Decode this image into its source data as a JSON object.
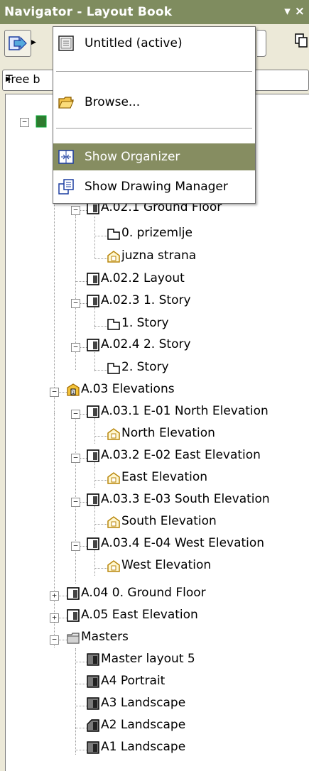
{
  "window": {
    "title": "Navigator - Layout Book",
    "controls": "▾ ×"
  },
  "filter": {
    "value": "Tree b"
  },
  "menu": {
    "items": [
      {
        "label": "Untitled (active)",
        "icon": "project-icon"
      },
      {
        "label": "Browse...",
        "icon": "folder-open-icon"
      },
      {
        "label": "Show Organizer",
        "icon": "organizer-icon",
        "highlighted": true
      },
      {
        "label": "Show Drawing Manager",
        "icon": "drawing-manager-icon"
      }
    ]
  },
  "tree": {
    "nodes": [
      {
        "label": "0. prizemlje",
        "icon": "floor-plan-icon"
      },
      {
        "label": "juzna strana",
        "icon": "elevation-view-icon"
      },
      {
        "label": "A.02.1 Ground Floor",
        "icon": "layout-icon"
      },
      {
        "label": "A.02.2 Layout",
        "icon": "layout-icon"
      },
      {
        "label": "A.02.3 1. Story",
        "icon": "layout-icon"
      },
      {
        "label": "1. Story",
        "icon": "floor-plan-icon"
      },
      {
        "label": "A.02.4 2. Story",
        "icon": "layout-icon"
      },
      {
        "label": "2. Story",
        "icon": "floor-plan-icon"
      },
      {
        "label": "A.03 Elevations",
        "icon": "subset-icon"
      },
      {
        "label": "A.03.1 E-01 North Elevation",
        "icon": "layout-icon"
      },
      {
        "label": "North Elevation",
        "icon": "elevation-view-icon"
      },
      {
        "label": "A.03.2 E-02 East Elevation",
        "icon": "layout-icon"
      },
      {
        "label": "East Elevation",
        "icon": "elevation-view-icon"
      },
      {
        "label": "A.03.3 E-03 South Elevation",
        "icon": "layout-icon"
      },
      {
        "label": "South Elevation",
        "icon": "elevation-view-icon"
      },
      {
        "label": "A.03.4 E-04 West Elevation",
        "icon": "layout-icon"
      },
      {
        "label": "West Elevation",
        "icon": "elevation-view-icon"
      },
      {
        "label": "A.04 0. Ground Floor",
        "icon": "layout-icon"
      },
      {
        "label": "A.05 East Elevation",
        "icon": "layout-icon"
      },
      {
        "label": "Masters",
        "icon": "masters-folder-icon"
      },
      {
        "label": "Master layout 5",
        "icon": "master-layout-icon"
      },
      {
        "label": "A4 Portrait",
        "icon": "master-layout-icon"
      },
      {
        "label": "A3 Landscape",
        "icon": "master-layout-icon"
      },
      {
        "label": "A2 Landscape",
        "icon": "master-layout-icon"
      },
      {
        "label": "A1 Landscape",
        "icon": "master-layout-icon"
      }
    ]
  },
  "colors": {
    "titlebar": "#7f8c5f",
    "highlight": "#868d61"
  }
}
